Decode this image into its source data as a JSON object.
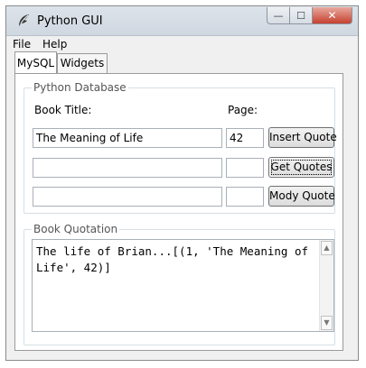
{
  "window": {
    "title": "Python GUI",
    "icon": "python-feather-icon"
  },
  "caption_buttons": {
    "minimize": "—",
    "maximize": "☐",
    "close": "✕"
  },
  "menu": {
    "items": [
      "File",
      "Help"
    ]
  },
  "tabs": [
    {
      "label": "MySQL",
      "active": true
    },
    {
      "label": "Widgets",
      "active": false
    }
  ],
  "database": {
    "group_title": "Python Database",
    "book_title_label": "Book Title:",
    "page_label": "Page:",
    "rows": [
      {
        "title": "The Meaning of Life",
        "page": "42",
        "button": "Insert Quote"
      },
      {
        "title": "",
        "page": "",
        "button": "Get Quotes"
      },
      {
        "title": "",
        "page": "",
        "button": "Mody Quote"
      }
    ]
  },
  "quotation": {
    "group_title": "Book Quotation",
    "text": "The life of Brian...[(1, 'The Meaning of Life', 42)]"
  },
  "scrollbar": {
    "up": "▲",
    "down": "▼"
  }
}
